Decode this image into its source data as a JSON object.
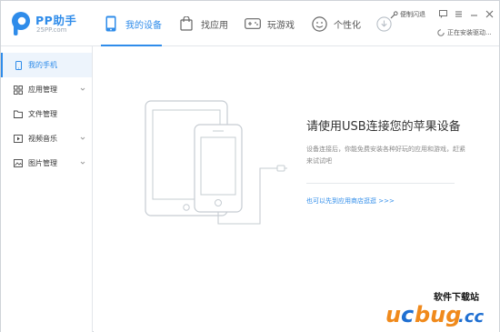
{
  "app": {
    "name": "PP助手",
    "site": "25PP.com"
  },
  "nav": {
    "items": [
      {
        "id": "my-device",
        "label": "我的设备",
        "icon": "phone-icon",
        "active": true
      },
      {
        "id": "find-apps",
        "label": "找应用",
        "icon": "shopping-bag-icon",
        "active": false
      },
      {
        "id": "games",
        "label": "玩游戏",
        "icon": "gamepad-icon",
        "active": false
      },
      {
        "id": "personalize",
        "label": "个性化",
        "icon": "smiley-icon",
        "active": false
      }
    ],
    "download_icon": "download-icon"
  },
  "topright": {
    "feedback": "便制闪退",
    "install_status": "正在安装驱动..."
  },
  "sidebar": {
    "items": [
      {
        "label": "我的手机",
        "icon": "phone-icon",
        "active": true,
        "expandable": false
      },
      {
        "label": "应用管理",
        "icon": "grid-icon",
        "active": false,
        "expandable": true
      },
      {
        "label": "文件管理",
        "icon": "folder-icon",
        "active": false,
        "expandable": false
      },
      {
        "label": "视频音乐",
        "icon": "play-icon",
        "active": false,
        "expandable": true
      },
      {
        "label": "图片管理",
        "icon": "image-icon",
        "active": false,
        "expandable": true
      }
    ]
  },
  "main": {
    "headline": "请使用USB连接您的苹果设备",
    "description": "设备连接后，你能免费安装各种好玩的应用和游戏，赶紧来试试吧",
    "try_link": "也可以先到应用商店逛逛 >>>"
  },
  "watermark": {
    "top_text": "软件下载站",
    "brand": "ucbug.cc"
  },
  "colors": {
    "accent": "#2f8cea",
    "watermark_orange": "#f08a1c",
    "watermark_blue": "#1f6fd1"
  }
}
